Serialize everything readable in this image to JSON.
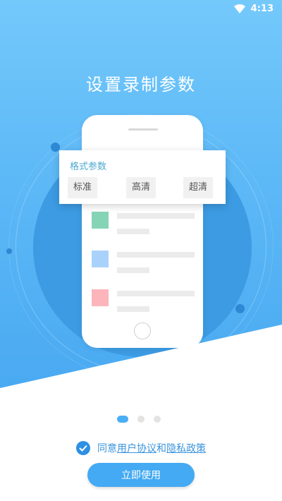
{
  "status_bar": {
    "time": "4:13"
  },
  "hero": {
    "title": "设置录制参数",
    "card": {
      "title": "格式参数",
      "options": [
        "标准",
        "高清",
        "超清"
      ]
    }
  },
  "pager": {
    "count": 3,
    "active": 0
  },
  "agreement": {
    "prefix": "同意",
    "user_agreement": "用户协议",
    "conjunction": "和",
    "privacy_policy": "隐私政策",
    "checked": true
  },
  "cta": {
    "label": "立即使用"
  },
  "colors": {
    "accent": "#43aaf3",
    "link": "#3a94dc",
    "hero_top": "#74c9fb",
    "hero_bottom": "#49a9f1"
  },
  "icons": [
    "wifi-icon",
    "check-icon"
  ]
}
